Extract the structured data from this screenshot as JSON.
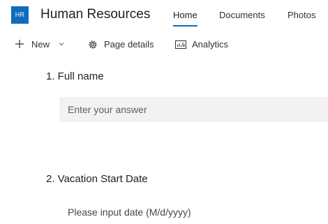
{
  "theme": {
    "accent": "#0f6cbd"
  },
  "site": {
    "logo_text": "HR",
    "title": "Human Resources"
  },
  "nav": {
    "items": [
      {
        "label": "Home",
        "active": true
      },
      {
        "label": "Documents",
        "active": false
      },
      {
        "label": "Photos",
        "active": false
      }
    ]
  },
  "commands": {
    "new_label": "New",
    "page_details_label": "Page details",
    "analytics_label": "Analytics",
    "icons": [
      "plus-icon",
      "chevron-down-icon",
      "gear-icon",
      "analytics-icon"
    ]
  },
  "form": {
    "questions": [
      {
        "number": "1.",
        "label": "Full name",
        "text": "1. Full name",
        "placeholder": "Enter your answer",
        "value": ""
      },
      {
        "number": "2.",
        "label": "Vacation Start Date",
        "text": "2. Vacation Start Date",
        "placeholder": "Please input date (M/d/yyyy)",
        "value": ""
      }
    ]
  }
}
